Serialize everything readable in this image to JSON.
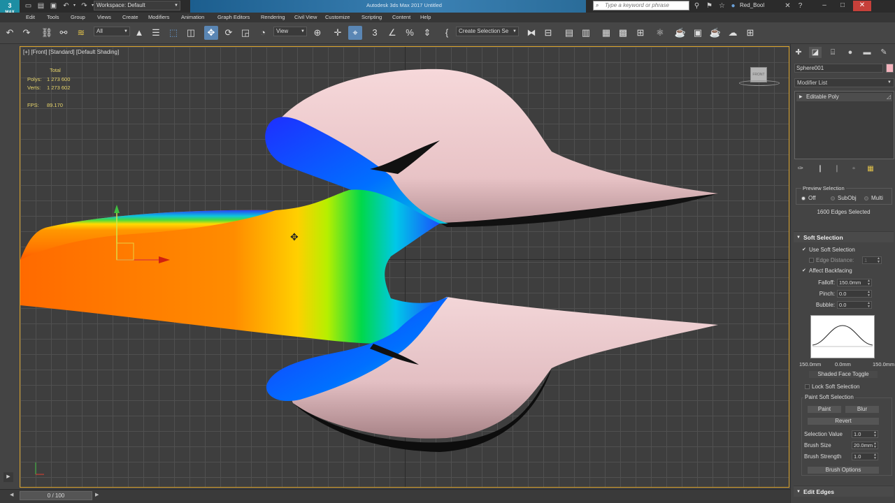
{
  "app": {
    "logo_text": "3",
    "logo_sub": "MAX",
    "workspace": "Workspace: Default",
    "title": "Autodesk 3ds Max 2017     Untitled",
    "search_placeholder": "Type a keyword or phrase",
    "user": "Red_Bool"
  },
  "menu": [
    "Edit",
    "Tools",
    "Group",
    "Views",
    "Create",
    "Modifiers",
    "Animation",
    "Graph Editors",
    "Rendering",
    "Civil View",
    "Customize",
    "Scripting",
    "Content",
    "Help"
  ],
  "toolbar": {
    "filter": "All",
    "refcoord": "View",
    "named_selection": "Create Selection Se"
  },
  "viewport": {
    "label": "[+] [Front] [Standard] [Default Shading]",
    "stats": {
      "header": "Total",
      "polys_label": "Polys:",
      "polys": "1 273 600",
      "verts_label": "Verts:",
      "verts": "1 273 602",
      "fps_label": "FPS:",
      "fps": "89.170"
    },
    "viewcube_label": "FRONT"
  },
  "timeline": {
    "frame": "0 / 100"
  },
  "command_panel": {
    "object_name": "Sphere001",
    "object_color": "#f4b3bd",
    "modifier_list": "Modifier List",
    "stack_item": "Editable Poly",
    "preview_selection": {
      "title": "Preview Selection",
      "options": [
        "Off",
        "SubObj",
        "Multi"
      ],
      "selected": "Off"
    },
    "selection_info": "1600 Edges Selected",
    "soft_selection": {
      "title": "Soft Selection",
      "use_soft_selection": "Use Soft Selection",
      "edge_distance_label": "Edge Distance:",
      "edge_distance": "1",
      "affect_backfacing": "Affect Backfacing",
      "falloff_label": "Falloff:",
      "falloff": "150.0mm",
      "pinch_label": "Pinch:",
      "pinch": "0.0",
      "bubble_label": "Bubble:",
      "bubble": "0.0",
      "curve_left": "150.0mm",
      "curve_mid": "0.0mm",
      "curve_right": "150.0mm",
      "shaded_face_toggle": "Shaded Face Toggle",
      "lock_soft_selection": "Lock Soft Selection",
      "paint_group": "Paint Soft Selection",
      "paint": "Paint",
      "blur": "Blur",
      "revert": "Revert",
      "selection_value_label": "Selection Value",
      "selection_value": "1.0",
      "brush_size_label": "Brush Size",
      "brush_size": "20.0mm",
      "brush_strength_label": "Brush Strength",
      "brush_strength": "1.0",
      "brush_options": "Brush Options"
    },
    "edit_edges": "Edit Edges"
  }
}
